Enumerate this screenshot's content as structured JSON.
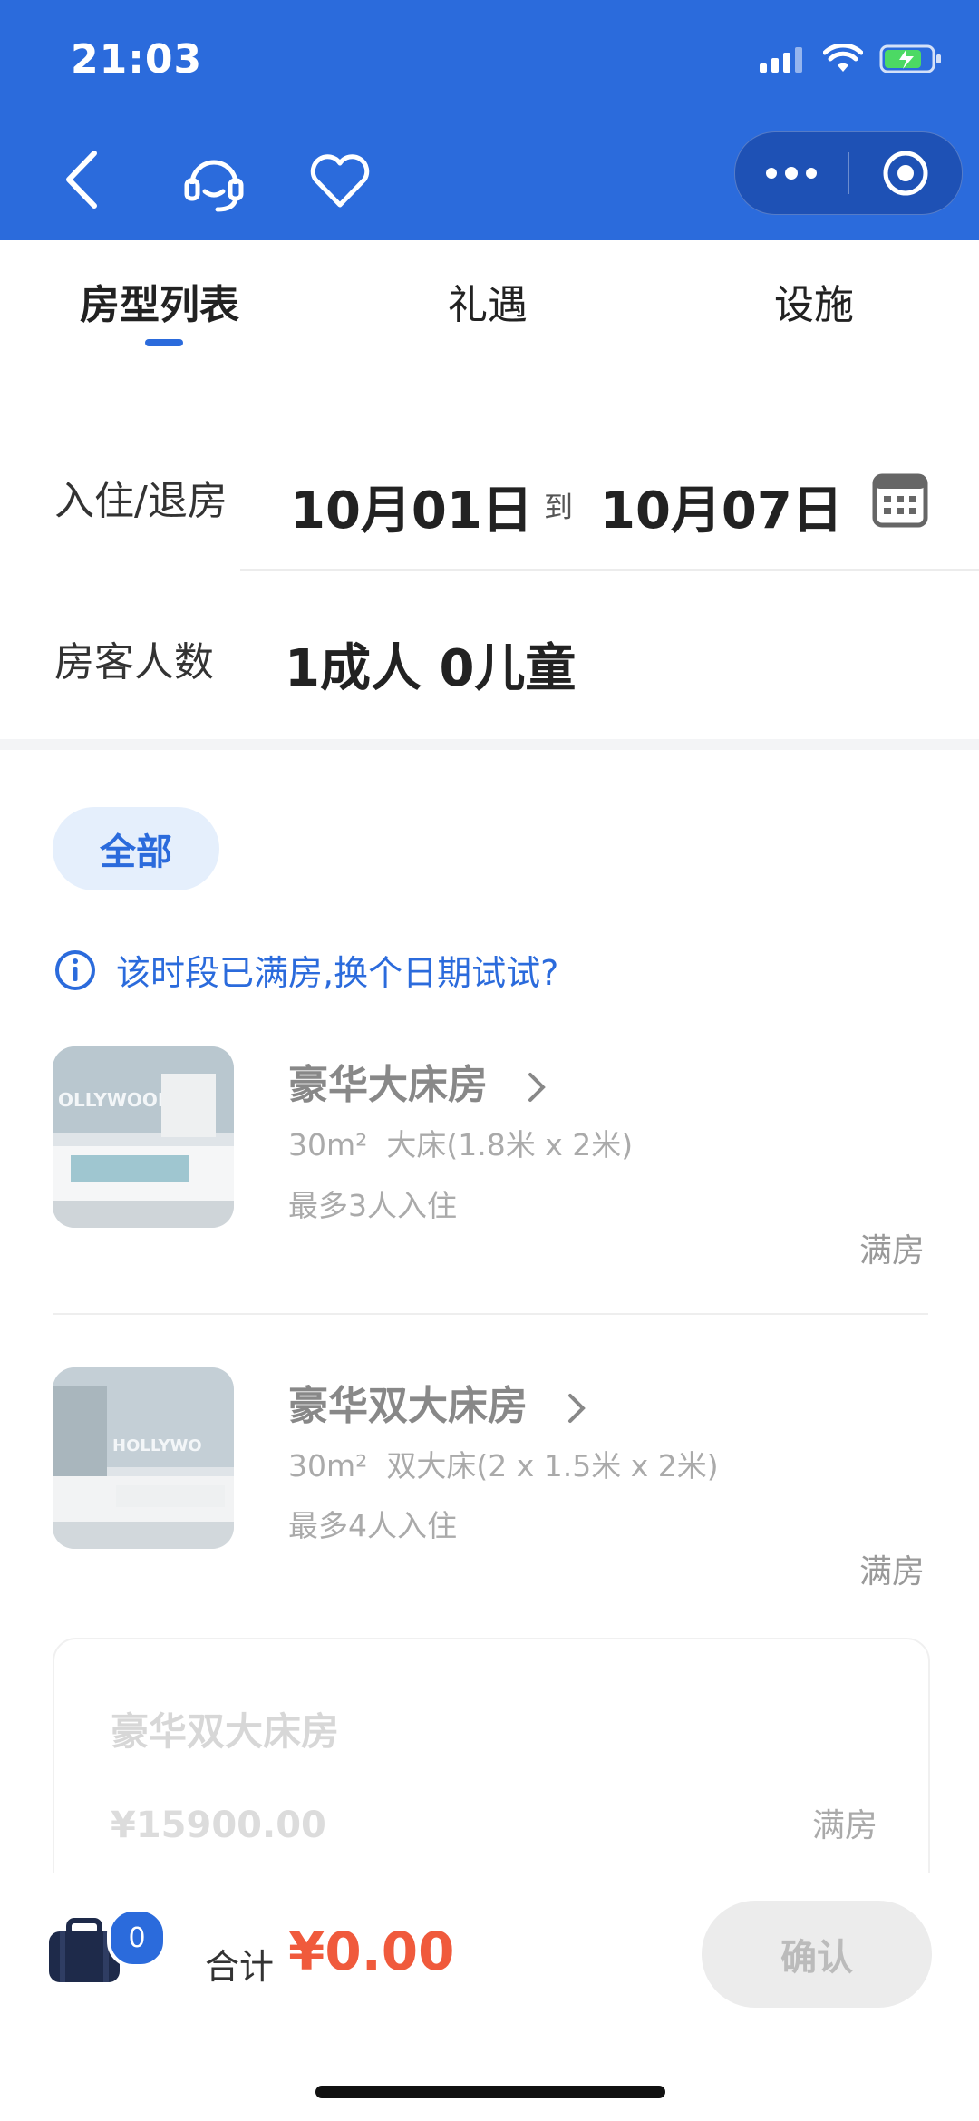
{
  "status": {
    "time": "21:03"
  },
  "tabs": [
    {
      "label": "房型列表"
    },
    {
      "label": "礼遇"
    },
    {
      "label": "设施"
    }
  ],
  "stay": {
    "label": "入住/退房",
    "checkin": "10月01日",
    "separator": "到",
    "checkout": "10月07日"
  },
  "guests": {
    "label": "房客人数",
    "value": "1成人 0儿童"
  },
  "filter": {
    "label": "全部"
  },
  "notice": "该时段已满房,换个日期试试?",
  "rooms": [
    {
      "name": "豪华大床房",
      "area": "30m²",
      "bed": "大床(1.8米 x 2米)",
      "capacity": "最多3人入住",
      "status": "满房",
      "image_text": "OLLYWOOD"
    },
    {
      "name": "豪华双大床房",
      "area": "30m²",
      "bed": "双大床(2 x 1.5米 x 2米)",
      "capacity": "最多4人入住",
      "status": "满房",
      "image_text": "HOLLYWO"
    }
  ],
  "selected_card": {
    "name": "豪华双大床房",
    "price": "¥15900.00",
    "status": "满房"
  },
  "cart": {
    "count": "0",
    "total_label": "合计",
    "total_amount": "¥0.00",
    "confirm_label": "确认"
  },
  "colors": {
    "brand": "#2b6bdc",
    "price": "#f05a3c"
  }
}
